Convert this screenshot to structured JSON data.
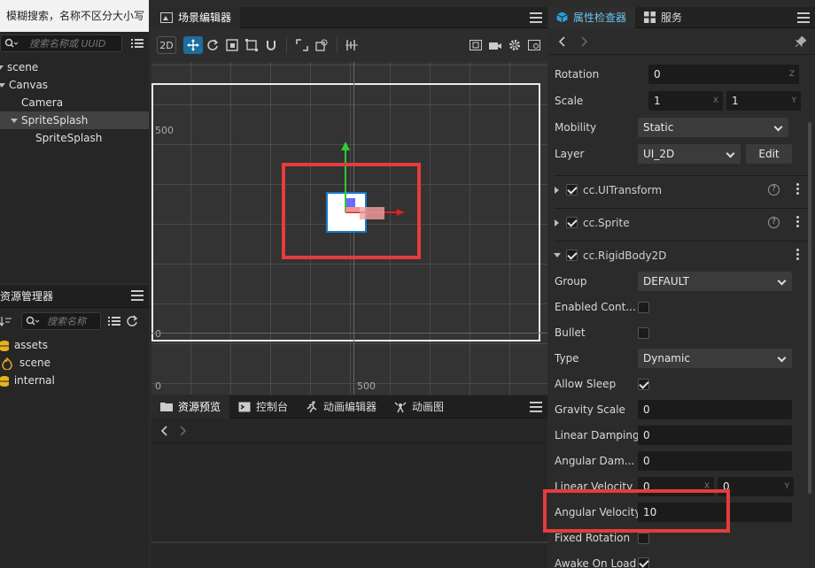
{
  "tooltip": "模糊搜索，名称不区分大小写",
  "hierarchy": {
    "search_placeholder": "搜索名称或 UUID",
    "items": [
      {
        "label": "scene",
        "indent": 0
      },
      {
        "label": "Canvas",
        "indent": 1
      },
      {
        "label": "Camera",
        "indent": 2
      },
      {
        "label": "SpriteSplash",
        "indent": 2
      },
      {
        "label": "SpriteSplash",
        "indent": 3
      }
    ]
  },
  "assets": {
    "title": "资源管理器",
    "search_placeholder": "搜索名称",
    "items": [
      "assets",
      "scene",
      "internal"
    ]
  },
  "scene_editor": {
    "title": "场景编辑器",
    "toolbar": {
      "mode_2d": "2D"
    },
    "labels": {
      "y500": "500",
      "y0": "0",
      "x0": "0",
      "x500": "500"
    }
  },
  "bottom_tabs": [
    "资源预览",
    "控制台",
    "动画编辑器",
    "动画图"
  ],
  "inspector": {
    "tabs": [
      "属性检查器",
      "服务"
    ],
    "rotation": {
      "label": "Rotation",
      "value": "0",
      "axis": "Z"
    },
    "scale": {
      "label": "Scale",
      "x": "1",
      "y": "1",
      "ax": "X",
      "ay": "Y"
    },
    "mobility": {
      "label": "Mobility",
      "value": "Static"
    },
    "layer": {
      "label": "Layer",
      "value": "UI_2D",
      "edit": "Edit"
    },
    "components": [
      "cc.UITransform",
      "cc.Sprite",
      "cc.RigidBody2D"
    ],
    "group": {
      "label": "Group",
      "value": "DEFAULT"
    },
    "enabled_contact": {
      "label": "Enabled Cont..."
    },
    "bullet": {
      "label": "Bullet"
    },
    "type": {
      "label": "Type",
      "value": "Dynamic"
    },
    "allow_sleep": {
      "label": "Allow Sleep"
    },
    "gravity_scale": {
      "label": "Gravity Scale",
      "value": "0"
    },
    "linear_damping": {
      "label": "Linear Damping",
      "value": "0"
    },
    "angular_damping": {
      "label": "Angular Dam...",
      "value": "0"
    },
    "linear_velocity": {
      "label": "Linear Velocity",
      "x": "0",
      "y": "0",
      "ax": "X",
      "ay": "Y"
    },
    "angular_velocity": {
      "label": "Angular Velocity",
      "value": "10"
    },
    "fixed_rotation": {
      "label": "Fixed Rotation"
    },
    "awake_on_load": {
      "label": "Awake On Load"
    }
  },
  "colors": {
    "accent": "#1d6e9e",
    "highlight": "#e53c3c"
  }
}
